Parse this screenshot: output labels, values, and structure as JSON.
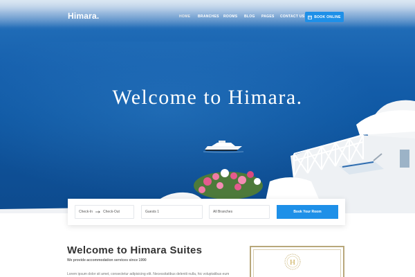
{
  "brand": {
    "name": "Himara."
  },
  "nav": {
    "items": [
      {
        "label": "HOME",
        "active": true
      },
      {
        "label": "BRANCHES",
        "active": false
      },
      {
        "label": "ROOMS",
        "active": false
      },
      {
        "label": "BLOG",
        "active": false
      },
      {
        "label": "PAGES",
        "active": false
      },
      {
        "label": "CONTACT US",
        "active": false
      }
    ],
    "cta_label": "BOOK ONLINE",
    "cta_icon": "calendar-icon"
  },
  "hero": {
    "title": "Welcome to Himara."
  },
  "booking": {
    "checkin": "Check-In",
    "checkout": "Check-Out",
    "arrow_icon": "arrow-right-icon",
    "guests": "Guests 1",
    "branches": "All Branches",
    "submit_label": "Book Your Room"
  },
  "welcome": {
    "title": "Welcome to Himara Suites",
    "subtitle": "We provide accommodation services since 1990",
    "body": "Lorem ipsum dolor sit amet, consectetur adipisicing elit. Necessitatibus deleniti nulla, hic voluptatibus eum"
  },
  "logo": {
    "letter": "H"
  },
  "colors": {
    "accent": "#1e90e8",
    "sea": "#1660ad",
    "gold": "#b8a77a"
  }
}
